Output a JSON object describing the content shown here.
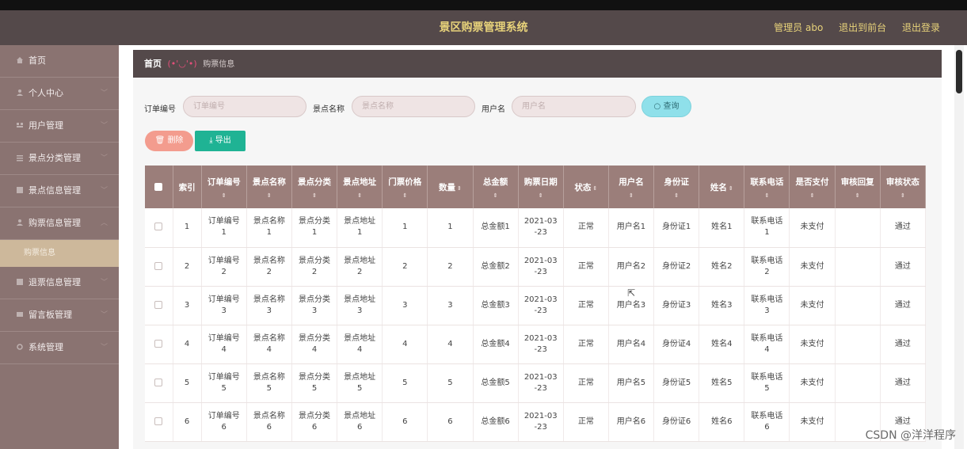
{
  "app": {
    "title": "景区购票管理系统",
    "admin_label": "管理员 abo",
    "to_front": "退出到前台",
    "logout": "退出登录"
  },
  "sidebar": {
    "items": [
      {
        "label": "首页"
      },
      {
        "label": "个人中心"
      },
      {
        "label": "用户管理"
      },
      {
        "label": "景点分类管理"
      },
      {
        "label": "景点信息管理"
      },
      {
        "label": "购票信息管理"
      },
      {
        "label": "购票信息",
        "active": true
      },
      {
        "label": "退票信息管理"
      },
      {
        "label": "留言板管理"
      },
      {
        "label": "系统管理"
      }
    ]
  },
  "breadcrumb": {
    "home": "首页",
    "face": "(•'◡'•)",
    "current": "购票信息"
  },
  "search": {
    "order_label": "订单编号",
    "order_placeholder": "订单编号",
    "spot_label": "景点名称",
    "spot_placeholder": "景点名称",
    "user_label": "用户名",
    "user_placeholder": "用户名",
    "query_button": "查询"
  },
  "toolbar": {
    "delete_button": "删除",
    "export_button": "导出"
  },
  "table": {
    "headers": [
      "索引",
      "订单编号",
      "景点名称",
      "景点分类",
      "景点地址",
      "门票价格",
      "数量",
      "总金额",
      "购票日期",
      "状态",
      "用户名",
      "身份证",
      "姓名",
      "联系电话",
      "是否支付",
      "审核回复",
      "审核状态"
    ],
    "rows": [
      {
        "idx": "1",
        "order": "订单编号\n1",
        "spot": "景点名称\n1",
        "category": "景点分类\n1",
        "address": "景点地址\n1",
        "price": "1",
        "qty": "1",
        "total": "总金额1",
        "date": "2021-03\n-23",
        "status": "正常",
        "user": "用户名1",
        "id": "身份证1",
        "name": "姓名1",
        "phone": "联系电话\n1",
        "paid": "未支付",
        "reply": "",
        "audit": "通过"
      },
      {
        "idx": "2",
        "order": "订单编号\n2",
        "spot": "景点名称\n2",
        "category": "景点分类\n2",
        "address": "景点地址\n2",
        "price": "2",
        "qty": "2",
        "total": "总金额2",
        "date": "2021-03\n-23",
        "status": "正常",
        "user": "用户名2",
        "id": "身份证2",
        "name": "姓名2",
        "phone": "联系电话\n2",
        "paid": "未支付",
        "reply": "",
        "audit": "通过"
      },
      {
        "idx": "3",
        "order": "订单编号\n3",
        "spot": "景点名称\n3",
        "category": "景点分类\n3",
        "address": "景点地址\n3",
        "price": "3",
        "qty": "3",
        "total": "总金额3",
        "date": "2021-03\n-23",
        "status": "正常",
        "user": "用户名3",
        "id": "身份证3",
        "name": "姓名3",
        "phone": "联系电话\n3",
        "paid": "未支付",
        "reply": "",
        "audit": "通过"
      },
      {
        "idx": "4",
        "order": "订单编号\n4",
        "spot": "景点名称\n4",
        "category": "景点分类\n4",
        "address": "景点地址\n4",
        "price": "4",
        "qty": "4",
        "total": "总金额4",
        "date": "2021-03\n-23",
        "status": "正常",
        "user": "用户名4",
        "id": "身份证4",
        "name": "姓名4",
        "phone": "联系电话\n4",
        "paid": "未支付",
        "reply": "",
        "audit": "通过"
      },
      {
        "idx": "5",
        "order": "订单编号\n5",
        "spot": "景点名称\n5",
        "category": "景点分类\n5",
        "address": "景点地址\n5",
        "price": "5",
        "qty": "5",
        "total": "总金额5",
        "date": "2021-03\n-23",
        "status": "正常",
        "user": "用户名5",
        "id": "身份证5",
        "name": "姓名5",
        "phone": "联系电话\n5",
        "paid": "未支付",
        "reply": "",
        "audit": "通过"
      },
      {
        "idx": "6",
        "order": "订单编号\n6",
        "spot": "景点名称\n6",
        "category": "景点分类\n6",
        "address": "景点地址\n6",
        "price": "6",
        "qty": "6",
        "total": "总金额6",
        "date": "2021-03\n-23",
        "status": "正常",
        "user": "用户名6",
        "id": "身份证6",
        "name": "姓名6",
        "phone": "联系电话\n6",
        "paid": "未支付",
        "reply": "",
        "audit": "通过"
      }
    ]
  },
  "watermark": "CSDN @洋洋程序",
  "colors": {
    "header_bg": "#54494a",
    "title_gold": "#e7d27a",
    "sidebar_bg": "#8a7371",
    "table_header": "#9b7e7a",
    "delete_btn": "#f39c8e",
    "export_btn": "#1fb394",
    "query_btn": "#8fe0ea"
  }
}
